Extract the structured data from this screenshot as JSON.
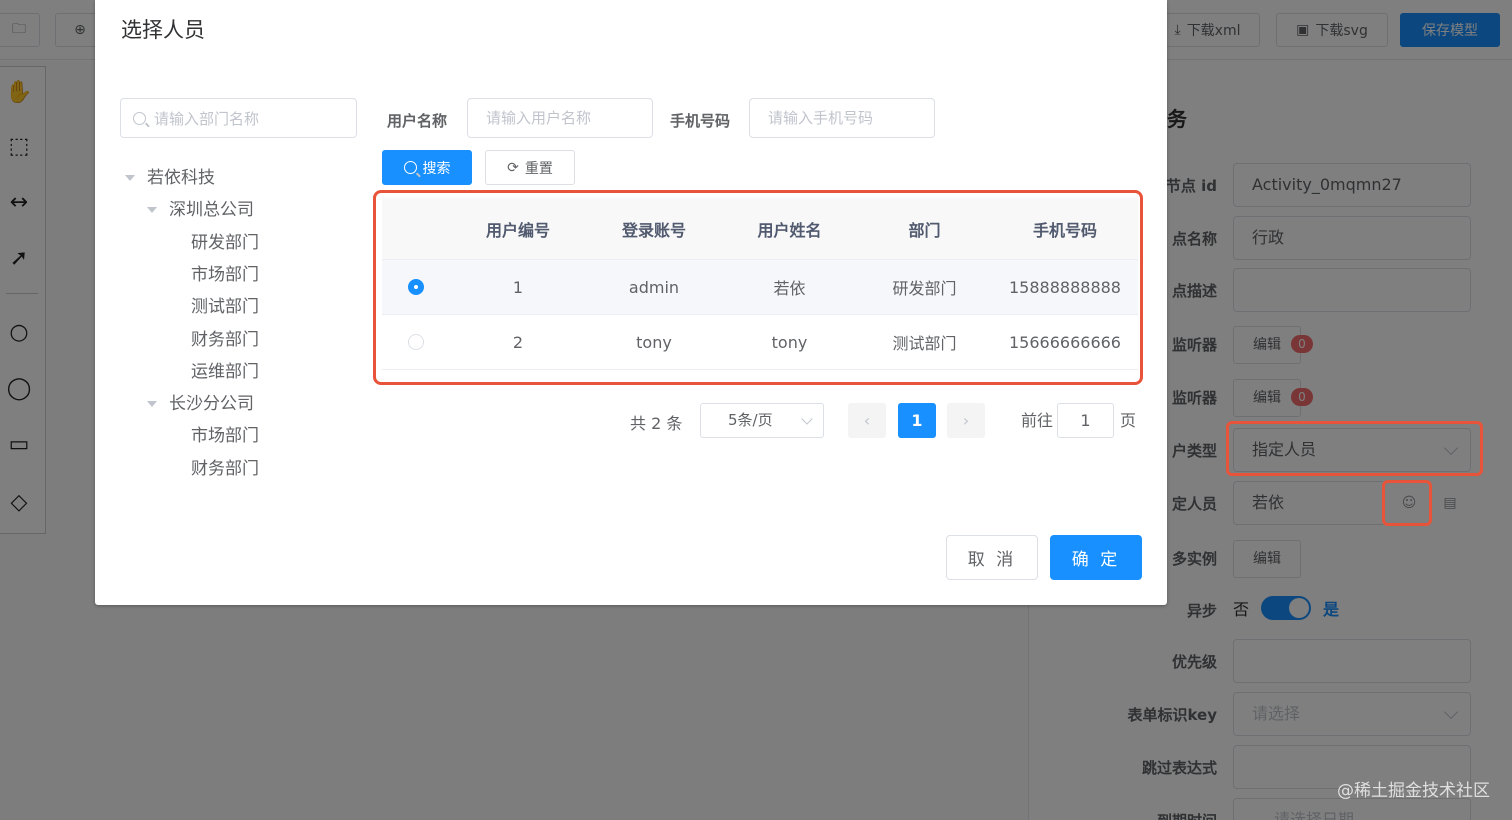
{
  "toolbar": {
    "download_xml": "下载xml",
    "download_svg": "下载svg",
    "save_model": "保存模型"
  },
  "panel": {
    "title_fragment": "务",
    "node_id_label": "节点 id",
    "node_id_value": "Activity_0mqmn27",
    "node_name_label": "点名称",
    "node_name_value": "行政",
    "node_desc_label": "点描述",
    "exec_listener_label": "监听器",
    "task_listener_label": "监听器",
    "edit_label": "编辑",
    "listener_count_1": "0",
    "listener_count_2": "0",
    "user_type_label": "户类型",
    "user_type_value": "指定人员",
    "assignee_label": "定人员",
    "assignee_value": "若依",
    "multi_instance_label": "多实例",
    "async_label": "异步",
    "async_off": "否",
    "async_on": "是",
    "priority_label": "优先级",
    "form_key_label": "表单标识key",
    "form_key_placeholder": "请选择",
    "skip_expr_label": "跳过表达式",
    "due_date_label": "到期时间",
    "due_date_placeholder": "请选择日期"
  },
  "dialog": {
    "title": "选择人员",
    "dept_search_placeholder": "请输入部门名称",
    "tree": {
      "root": "若依科技",
      "branch1": "深圳总公司",
      "branch1_children": [
        "研发部门",
        "市场部门",
        "测试部门",
        "财务部门",
        "运维部门"
      ],
      "branch2": "长沙分公司",
      "branch2_children": [
        "市场部门",
        "财务部门"
      ]
    },
    "form": {
      "username_label": "用户名称",
      "username_placeholder": "请输入用户名称",
      "phone_label": "手机号码",
      "phone_placeholder": "请输入手机号码",
      "search_btn": "搜索",
      "reset_btn": "重置"
    },
    "table": {
      "headers": [
        "用户编号",
        "登录账号",
        "用户姓名",
        "部门",
        "手机号码"
      ],
      "rows": [
        [
          "1",
          "admin",
          "若依",
          "研发部门",
          "15888888888"
        ],
        [
          "2",
          "tony",
          "tony",
          "测试部门",
          "15666666666"
        ]
      ]
    },
    "pagination": {
      "total": "共 2 条",
      "page_size": "5条/页",
      "current": "1",
      "goto_prefix": "前往",
      "goto_value": "1",
      "goto_suffix": "页"
    },
    "cancel_btn": "取 消",
    "confirm_btn": "确 定"
  },
  "watermark": "@稀土掘金技术社区",
  "colors": {
    "primary": "#1890ff",
    "highlight_border": "#e8543a",
    "badge": "#f56c6c"
  }
}
